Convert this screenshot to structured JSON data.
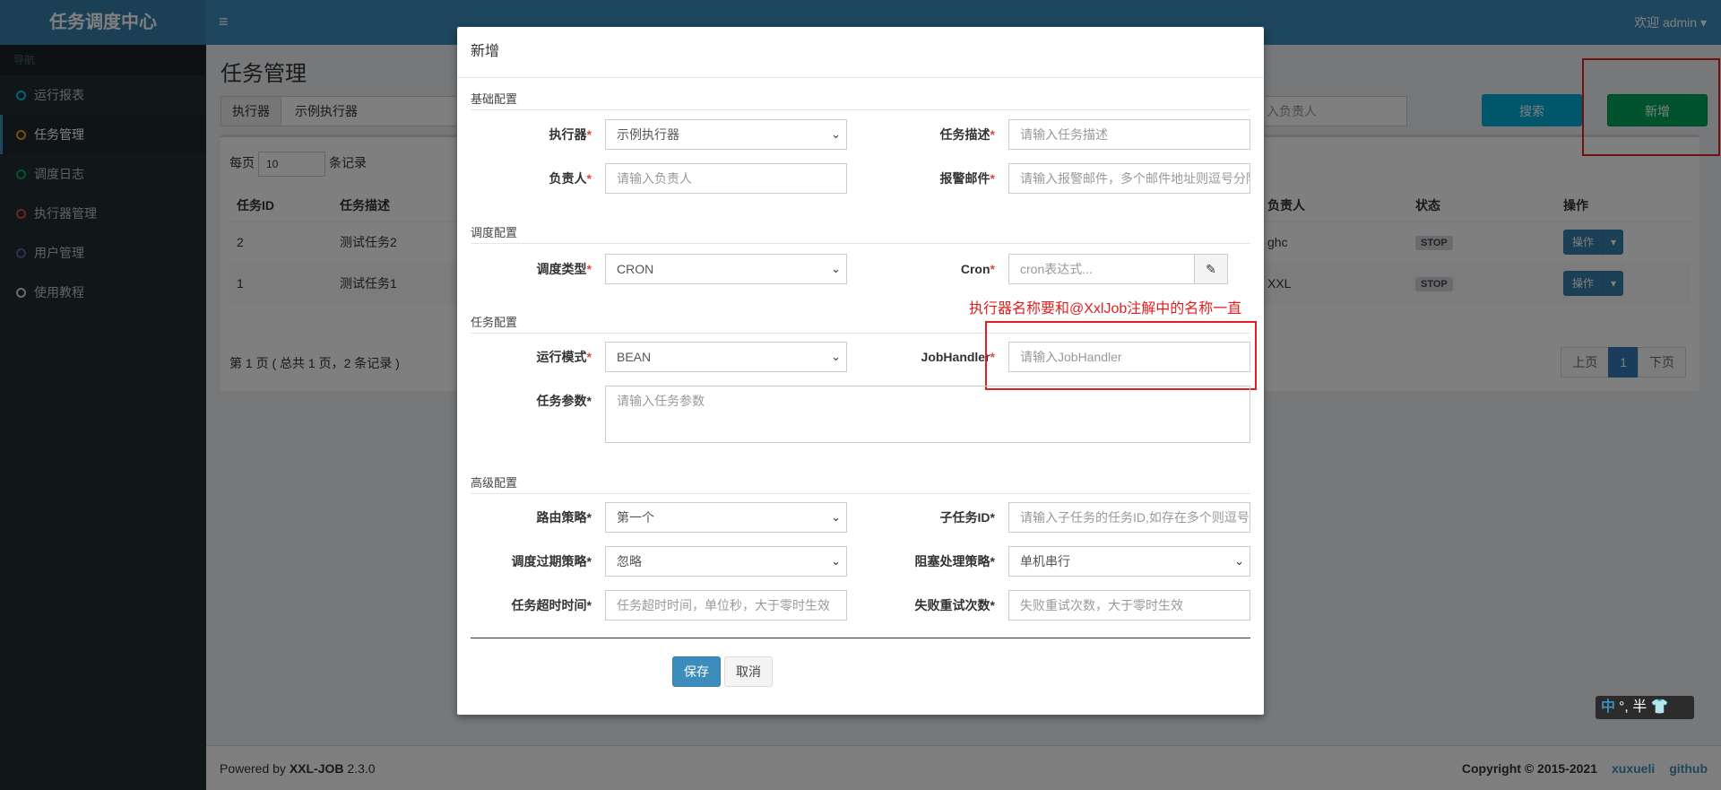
{
  "app": {
    "logo": "任务调度中心",
    "welcome": "欢迎 admin ▾",
    "toggle_icon": "≡"
  },
  "sidebar": {
    "header": "导航",
    "items": [
      {
        "label": "运行报表",
        "color": "#00c0ef"
      },
      {
        "label": "任务管理",
        "color": "#f39c12"
      },
      {
        "label": "调度日志",
        "color": "#00a65a"
      },
      {
        "label": "执行器管理",
        "color": "#dd4b39"
      },
      {
        "label": "用户管理",
        "color": "#605ca8"
      },
      {
        "label": "使用教程",
        "color": "#d2d6de"
      }
    ]
  },
  "page": {
    "title": "任务管理",
    "filter_label": "执行器",
    "filter_value": "示例执行器",
    "owner_placeholder": "入负责人",
    "search_label": "搜索",
    "add_label": "新增",
    "perpage_prefix": "每页",
    "perpage_value": "10",
    "perpage_suffix": "条记录"
  },
  "table": {
    "headers": [
      "任务ID",
      "任务描述",
      "负责人",
      "状态",
      "操作"
    ],
    "rows": [
      {
        "id": "2",
        "desc": "测试任务2",
        "owner": "ghc",
        "status": "STOP",
        "op": "操作"
      },
      {
        "id": "1",
        "desc": "测试任务1",
        "owner": "XXL",
        "status": "STOP",
        "op": "操作"
      }
    ]
  },
  "pager": {
    "info": "第 1 页 ( 总共 1 页，2 条记录 )",
    "prev": "上页",
    "current": "1",
    "next": "下页"
  },
  "footer": {
    "powered": "Powered by",
    "brand": "XXL-JOB",
    "version": "2.3.0",
    "copyright": "Copyright © 2015-2021",
    "link1": "xuxueli",
    "link2": "github"
  },
  "modal": {
    "title": "新增",
    "sections": {
      "basic": "基础配置",
      "schedule": "调度配置",
      "task": "任务配置",
      "advanced": "高级配置"
    },
    "labels": {
      "executor": "执行器",
      "desc": "任务描述",
      "owner": "负责人",
      "alarm": "报警邮件",
      "schedule_type": "调度类型",
      "cron": "Cron",
      "run_mode": "运行模式",
      "job_handler": "JobHandler",
      "param": "任务参数",
      "route": "路由策略",
      "child": "子任务ID",
      "misfire": "调度过期策略",
      "block": "阻塞处理策略",
      "timeout": "任务超时时间",
      "retry": "失败重试次数"
    },
    "values": {
      "executor": "示例执行器",
      "schedule_type": "CRON",
      "run_mode": "BEAN",
      "route": "第一个",
      "misfire": "忽略",
      "block": "单机串行"
    },
    "placeholders": {
      "desc": "请输入任务描述",
      "owner": "请输入负责人",
      "alarm": "请输入报警邮件，多个邮件地址则逗号分隔",
      "cron": "cron表达式...",
      "job_handler": "请输入JobHandler",
      "param": "请输入任务参数",
      "child": "请输入子任务的任务ID,如存在多个则逗号分隔",
      "timeout": "任务超时时间，单位秒，大于零时生效",
      "retry": "失败重试次数，大于零时生效"
    },
    "save": "保存",
    "cancel": "取消"
  },
  "annotation": "执行器名称要和@XxlJob注解中的名称一直",
  "ime": {
    "zh": "中",
    "rest": "°, 半 👕"
  }
}
